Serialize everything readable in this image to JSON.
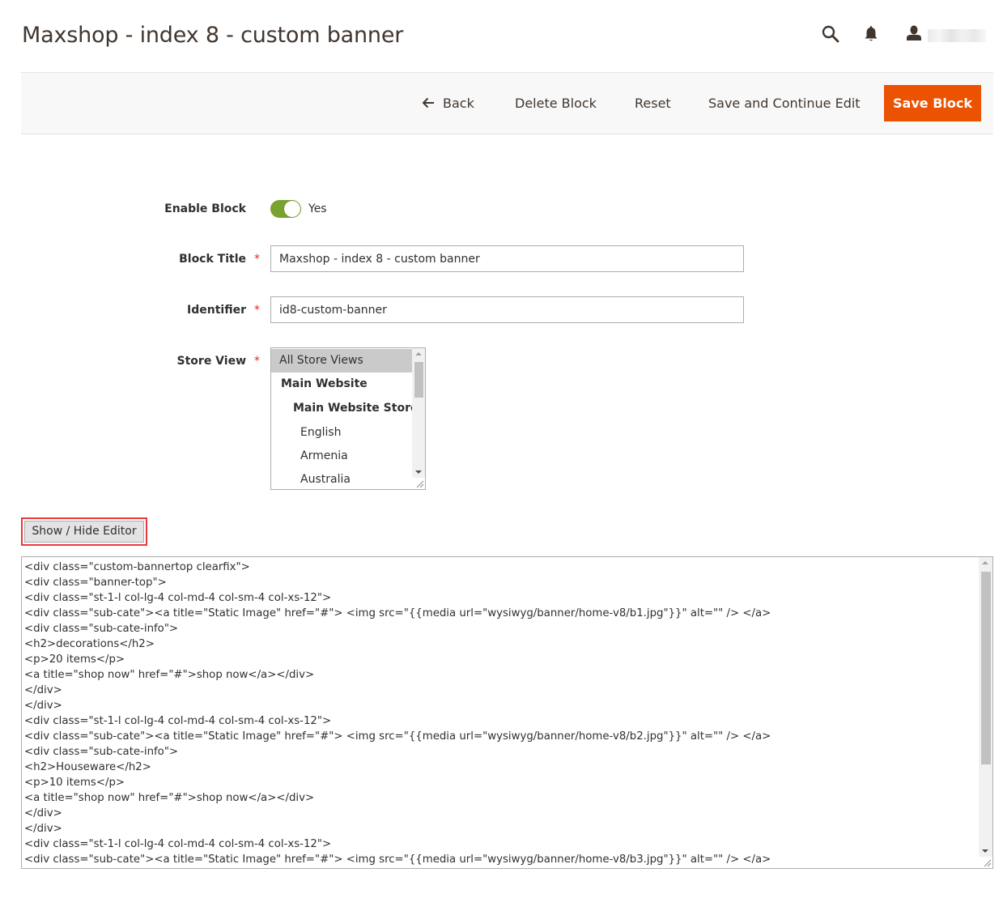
{
  "page": {
    "title": "Maxshop - index 8 - custom banner"
  },
  "header": {
    "search_icon": "search-icon",
    "notifications_icon": "bell-icon",
    "account_icon": "user-icon"
  },
  "toolbar": {
    "back_label": "Back",
    "delete_label": "Delete Block",
    "reset_label": "Reset",
    "save_continue_label": "Save and Continue Edit",
    "save_label": "Save Block",
    "accent_color": "#eb5202"
  },
  "form": {
    "enable_block": {
      "label": "Enable Block",
      "value_text": "Yes",
      "checked": true,
      "on_color": "#79a22e"
    },
    "block_title": {
      "label": "Block Title",
      "value": "Maxshop - index 8 - custom banner"
    },
    "identifier": {
      "label": "Identifier",
      "value": "id8-custom-banner"
    },
    "store_view": {
      "label": "Store View",
      "options": [
        {
          "label": "All Store Views",
          "kind": "option",
          "selected": true
        },
        {
          "label": "Main Website",
          "kind": "group"
        },
        {
          "label": "Main Website Store",
          "kind": "group"
        },
        {
          "label": "English",
          "kind": "option"
        },
        {
          "label": "Armenia",
          "kind": "option"
        },
        {
          "label": "Australia",
          "kind": "option"
        }
      ]
    },
    "required_marker": "*"
  },
  "editor": {
    "toggle_label": "Show / Hide Editor",
    "content_lines": [
      "<div class=\"custom-bannertop clearfix\">",
      "<div class=\"banner-top\">",
      "<div class=\"st-1-l col-lg-4 col-md-4 col-sm-4 col-xs-12\">",
      "<div class=\"sub-cate\"><a title=\"Static Image\" href=\"#\"> <img src=\"{{media url=\"wysiwyg/banner/home-v8/b1.jpg\"}}\" alt=\"\" /> </a>",
      "<div class=\"sub-cate-info\">",
      "<h2>decorations</h2>",
      "<p>20 items</p>",
      "<a title=\"shop now\" href=\"#\">shop now</a></div>",
      "</div>",
      "</div>",
      "<div class=\"st-1-l col-lg-4 col-md-4 col-sm-4 col-xs-12\">",
      "<div class=\"sub-cate\"><a title=\"Static Image\" href=\"#\"> <img src=\"{{media url=\"wysiwyg/banner/home-v8/b2.jpg\"}}\" alt=\"\" /> </a>",
      "<div class=\"sub-cate-info\">",
      "<h2>Houseware</h2>",
      "<p>10 items</p>",
      "<a title=\"shop now\" href=\"#\">shop now</a></div>",
      "</div>",
      "</div>",
      "<div class=\"st-1-l col-lg-4 col-md-4 col-sm-4 col-xs-12\">",
      "<div class=\"sub-cate\"><a title=\"Static Image\" href=\"#\"> <img src=\"{{media url=\"wysiwyg/banner/home-v8/b3.jpg\"}}\" alt=\"\" /> </a>"
    ]
  }
}
